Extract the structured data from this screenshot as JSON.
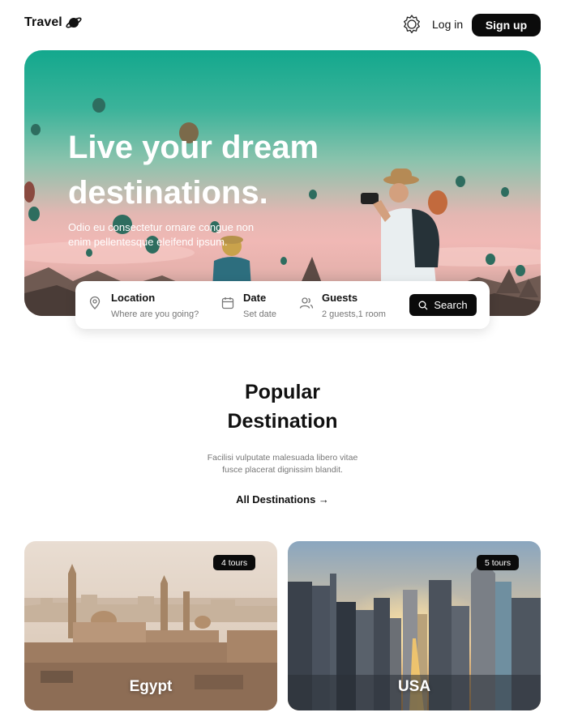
{
  "brand": {
    "name": "Travel",
    "icon": "planet-icon"
  },
  "header": {
    "settings_icon": "gear-icon",
    "login_label": "Log in",
    "signup_label": "Sign up"
  },
  "hero": {
    "title": "Live your dream destinations.",
    "subtitle": "Odio eu consectetur ornare congue non enim pellentesque eleifend ipsum."
  },
  "search": {
    "location": {
      "label": "Location",
      "placeholder": "Where are you going?",
      "icon": "map-pin-icon"
    },
    "date": {
      "label": "Date",
      "placeholder": "Set date",
      "icon": "calendar-icon"
    },
    "guests": {
      "label": "Guests",
      "value": "2 guests,1 room",
      "icon": "users-icon"
    },
    "button_label": "Search",
    "button_icon": "search-icon"
  },
  "popular": {
    "title": "Popular Destination",
    "description": "Facilisi vulputate malesuada libero vitae fusce placerat dignissim blandit.",
    "all_link": "All Destinations →"
  },
  "destinations": [
    {
      "name": "Egypt",
      "tours": "4 tours"
    },
    {
      "name": "USA",
      "tours": "5 tours"
    }
  ],
  "colors": {
    "primary": "#0b0b0b",
    "hero_teal": "#13a88d",
    "hero_pink": "#f0b8b5",
    "text_muted": "#777777"
  }
}
